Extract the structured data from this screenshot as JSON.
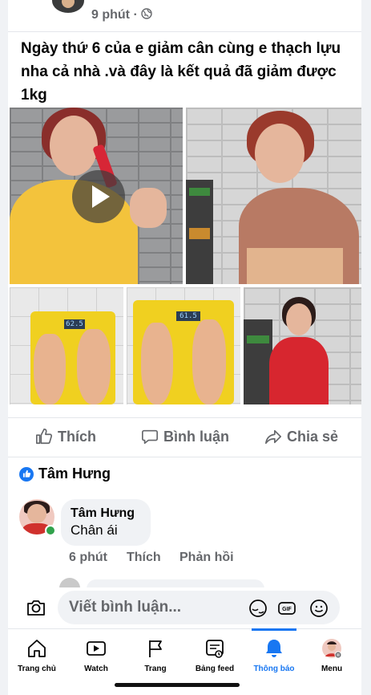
{
  "post": {
    "time": "9 phút ·",
    "text": "Ngày thứ 6 của e giảm cân cùng e thạch lựu nha cả nhà .và đây là kết quả đã giảm được 1kg",
    "scale_readings": [
      "62.5",
      "61.5"
    ]
  },
  "actions": {
    "like": "Thích",
    "comment": "Bình luận",
    "share": "Chia sẻ"
  },
  "reactions": {
    "name": "Tâm Hưng"
  },
  "comment": {
    "author": "Tâm Hưng",
    "text": "Chân ái",
    "time": "6 phút",
    "like": "Thích",
    "reply": "Phản hồi"
  },
  "composer": {
    "placeholder": "Viết bình luận..."
  },
  "tabs": [
    {
      "label": "Trang chủ",
      "icon": "home-icon"
    },
    {
      "label": "Watch",
      "icon": "watch-icon"
    },
    {
      "label": "Trang",
      "icon": "flag-icon"
    },
    {
      "label": "Bảng feed",
      "icon": "feed-icon"
    },
    {
      "label": "Thông báo",
      "icon": "bell-icon",
      "active": true
    },
    {
      "label": "Menu",
      "icon": "menu-avatar-icon"
    }
  ],
  "colors": {
    "accent": "#1877f2",
    "online": "#31a24c",
    "secondary_text": "#65676b"
  }
}
